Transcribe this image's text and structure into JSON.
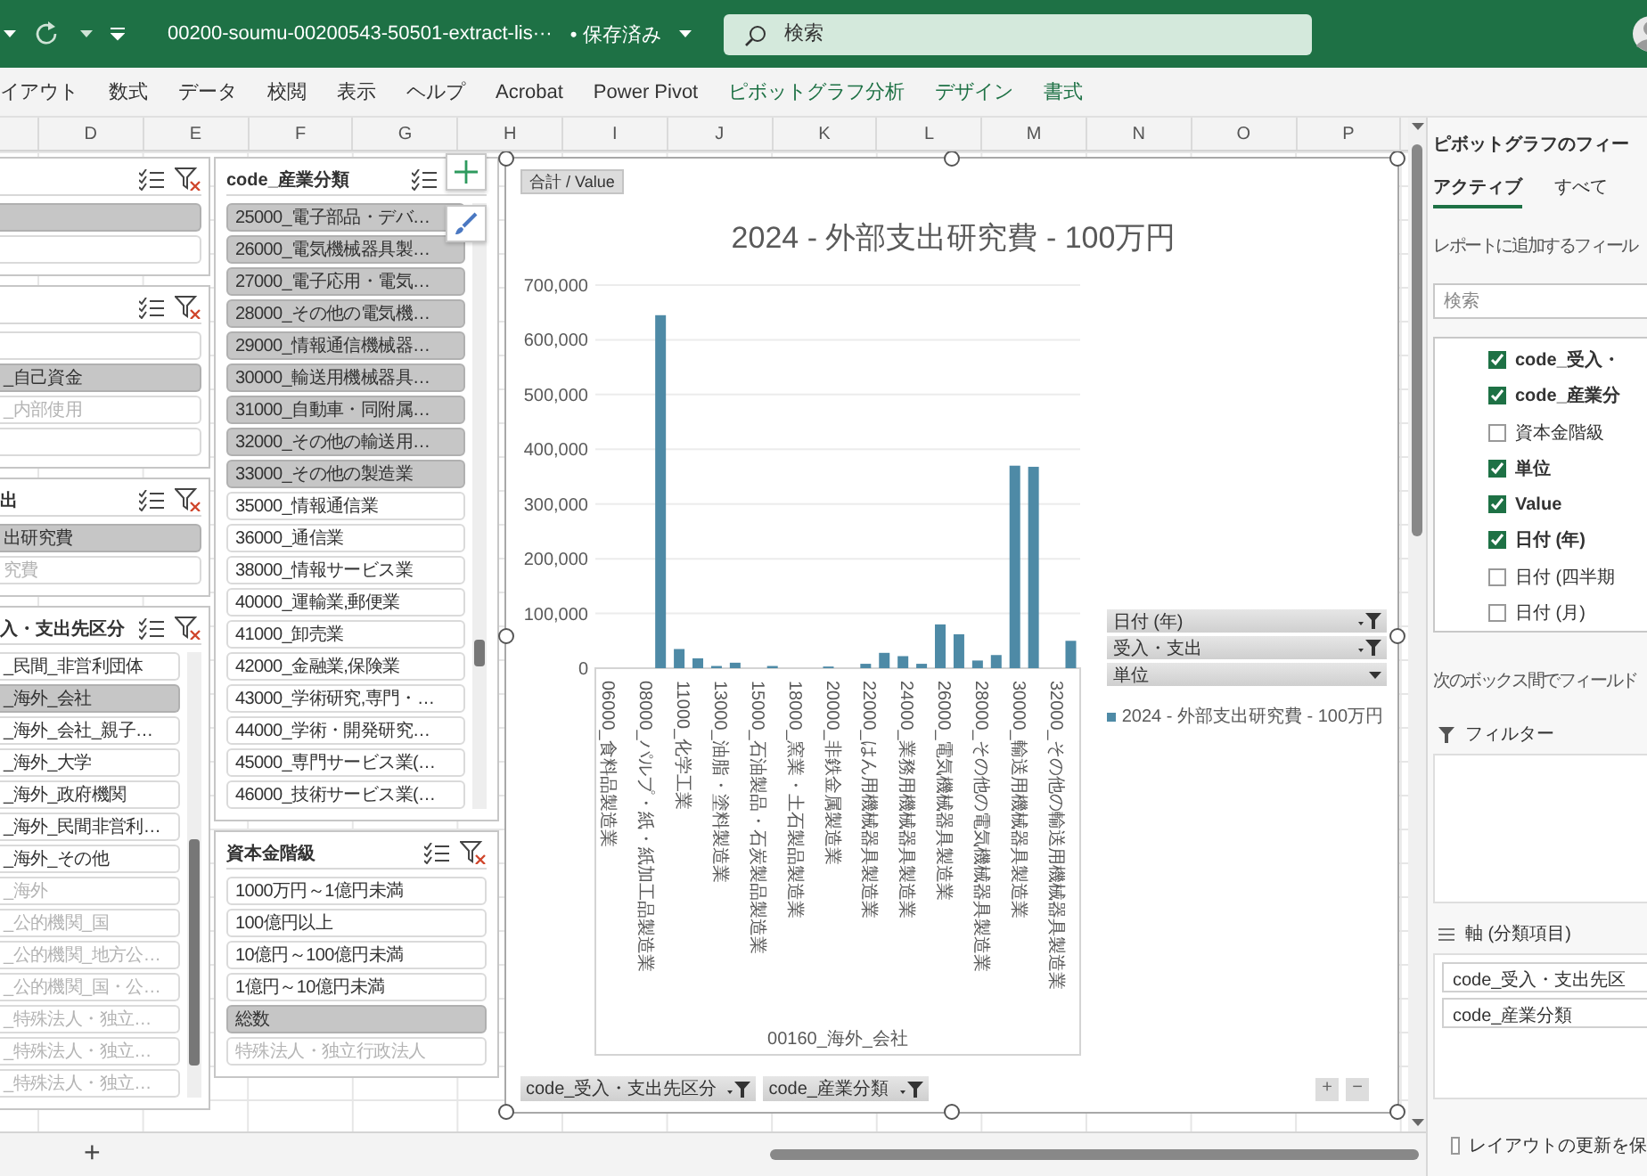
{
  "title_bar": {
    "file_name": "00200-soumu-00200543-50501-extract-lis···",
    "save_status": "• 保存済み",
    "search_placeholder": "検索"
  },
  "ribbon_tabs": [
    {
      "label": "イアウト",
      "contextual": false
    },
    {
      "label": "数式",
      "contextual": false
    },
    {
      "label": "データ",
      "contextual": false
    },
    {
      "label": "校閲",
      "contextual": false
    },
    {
      "label": "表示",
      "contextual": false
    },
    {
      "label": "ヘルプ",
      "contextual": false
    },
    {
      "label": "Acrobat",
      "contextual": false
    },
    {
      "label": "Power Pivot",
      "contextual": false
    },
    {
      "label": "ピボットグラフ分析",
      "contextual": true
    },
    {
      "label": "デザイン",
      "contextual": true
    },
    {
      "label": "書式",
      "contextual": true
    }
  ],
  "column_headers": [
    "D",
    "E",
    "F",
    "G",
    "H",
    "I",
    "J",
    "K",
    "L",
    "M",
    "N",
    "O",
    "P"
  ],
  "slicers_left": [
    {
      "items": [
        {
          "selected": true
        },
        {
          "selected": false
        }
      ]
    },
    {
      "items": [
        {
          "selected": false
        },
        {
          "label": "_自己資金",
          "selected": true,
          "has_data": true
        },
        {
          "label": "_内部使用",
          "selected": false,
          "has_data": false
        },
        {
          "selected": false
        }
      ]
    },
    {
      "title": "出",
      "items": [
        {
          "label": "出研究費",
          "selected": true,
          "has_data": true
        },
        {
          "label": "究費",
          "selected": false,
          "has_data": false
        }
      ]
    },
    {
      "title": "入・支出先区分",
      "items": [
        {
          "label": "_民間_非営利団体",
          "selected": false,
          "has_data": true
        },
        {
          "label": "_海外_会社",
          "selected": true,
          "has_data": true
        },
        {
          "label": "_海外_会社_親子…",
          "selected": false,
          "has_data": true
        },
        {
          "label": "_海外_大学",
          "selected": false,
          "has_data": true
        },
        {
          "label": "_海外_政府機関",
          "selected": false,
          "has_data": true
        },
        {
          "label": "_海外_民間非営利…",
          "selected": false,
          "has_data": true
        },
        {
          "label": "_海外_その他",
          "selected": false,
          "has_data": true
        },
        {
          "label": "_海外",
          "selected": false,
          "has_data": false
        },
        {
          "label": "_公的機関_国",
          "selected": false,
          "has_data": false
        },
        {
          "label": "_公的機関_地方公…",
          "selected": false,
          "has_data": false
        },
        {
          "label": "_公的機関_国・公…",
          "selected": false,
          "has_data": false
        },
        {
          "label": "_特殊法人・独立…",
          "selected": false,
          "has_data": false
        },
        {
          "label": "_特殊法人・独立…",
          "selected": false,
          "has_data": false
        },
        {
          "label": "_特殊法人・独立…",
          "selected": false,
          "has_data": false
        }
      ]
    }
  ],
  "slicers_middle": [
    {
      "title": "code_産業分類",
      "clear_filter_icon": false,
      "items": [
        {
          "label": "25000_電子部品・デバ…",
          "selected": true,
          "has_data": true
        },
        {
          "label": "26000_電気機械器具製…",
          "selected": true,
          "has_data": true
        },
        {
          "label": "27000_電子応用・電気…",
          "selected": true,
          "has_data": true
        },
        {
          "label": "28000_その他の電気機…",
          "selected": true,
          "has_data": true
        },
        {
          "label": "29000_情報通信機械器…",
          "selected": true,
          "has_data": true
        },
        {
          "label": "30000_輸送用機械器具…",
          "selected": true,
          "has_data": true
        },
        {
          "label": "31000_自動車・同附属…",
          "selected": true,
          "has_data": true
        },
        {
          "label": "32000_その他の輸送用…",
          "selected": true,
          "has_data": true
        },
        {
          "label": "33000_その他の製造業",
          "selected": true,
          "has_data": true
        },
        {
          "label": "35000_情報通信業",
          "selected": false,
          "has_data": true
        },
        {
          "label": "36000_通信業",
          "selected": false,
          "has_data": true
        },
        {
          "label": "38000_情報サービス業",
          "selected": false,
          "has_data": true
        },
        {
          "label": "40000_運輸業,郵便業",
          "selected": false,
          "has_data": true
        },
        {
          "label": "41000_卸売業",
          "selected": false,
          "has_data": true
        },
        {
          "label": "42000_金融業,保険業",
          "selected": false,
          "has_data": true
        },
        {
          "label": "43000_学術研究,専門・…",
          "selected": false,
          "has_data": true
        },
        {
          "label": "44000_学術・開発研究…",
          "selected": false,
          "has_data": true
        },
        {
          "label": "45000_専門サービス業(…",
          "selected": false,
          "has_data": true
        },
        {
          "label": "46000_技術サービス業(…",
          "selected": false,
          "has_data": true
        }
      ]
    },
    {
      "title": "資本金階級",
      "items": [
        {
          "label": "1000万円～1億円未満",
          "selected": false,
          "has_data": true
        },
        {
          "label": "100億円以上",
          "selected": false,
          "has_data": true
        },
        {
          "label": "10億円～100億円未満",
          "selected": false,
          "has_data": true
        },
        {
          "label": "1億円～10億円未満",
          "selected": false,
          "has_data": true
        },
        {
          "label": "総数",
          "selected": true,
          "has_data": true
        },
        {
          "label": "特殊法人・独立行政法人",
          "selected": false,
          "has_data": false
        }
      ]
    }
  ],
  "chart": {
    "value_button": "合計 / Value",
    "chart_data": {
      "type": "bar",
      "title": "2024 - 外部支出研究費 - 100万円",
      "xlabel": "00160_海外_会社",
      "categories": [
        "06000_食料品製造業",
        null,
        "08000_パルプ・紙・紙加工品製造業",
        null,
        "11000_化学工業",
        null,
        "13000_油脂・塗料製造業",
        null,
        "15000_石油製品・石炭製品製造業",
        null,
        "18000_窯業・土石製品製造業",
        null,
        "20000_非鉄金属製造業",
        null,
        "22000_はん用機械器具製造業",
        null,
        "24000_業務用機械器具製造業",
        null,
        "26000_電気機械器具製造業",
        null,
        "28000_その他の電気機械器具製造業",
        null,
        "30000_輸送用機械器具製造業",
        null,
        "32000_その他の輸送用機械器具製造業",
        null
      ],
      "series": [
        {
          "name": "2024 - 外部支出研究費 - 100万円",
          "color": "#4e8aa6",
          "values": [
            null,
            null,
            null,
            645000,
            35000,
            18000,
            4000,
            10000,
            null,
            4000,
            null,
            null,
            3000,
            null,
            8000,
            28000,
            22000,
            8000,
            80000,
            62000,
            14000,
            24000,
            370000,
            368000,
            null,
            50000
          ]
        }
      ],
      "ylim": [
        0,
        700000
      ],
      "grid": true,
      "yticks": [
        {
          "value": 0,
          "label": "0"
        },
        {
          "value": 100000,
          "label": "100,000"
        },
        {
          "value": 200000,
          "label": "200,000"
        },
        {
          "value": 300000,
          "label": "300,000"
        },
        {
          "value": 400000,
          "label": "400,000"
        },
        {
          "value": 500000,
          "label": "500,000"
        },
        {
          "value": 600000,
          "label": "600,000"
        },
        {
          "value": 700000,
          "label": "700,000"
        }
      ]
    },
    "legend_field_buttons": [
      {
        "label": "日付 (年)",
        "filtered": true
      },
      {
        "label": "受入・支出",
        "filtered": true
      },
      {
        "label": "単位",
        "filtered": false
      }
    ],
    "axis_field_buttons": [
      {
        "label": "code_受入・支出先区分",
        "filtered": true
      },
      {
        "label": "code_産業分類",
        "filtered": true
      }
    ],
    "zoom_buttons": [
      "+",
      "−"
    ]
  },
  "sheet_bar": {
    "add_label": "+"
  },
  "field_pane": {
    "title": "ピボットグラフのフィー",
    "tabs": [
      {
        "label": "アクティブ",
        "selected": true
      },
      {
        "label": "すべて",
        "selected": false
      }
    ],
    "instruction": "レポートに追加するフィール",
    "search_placeholder": "検索",
    "fields": [
      {
        "label": "code_受入・",
        "checked": true
      },
      {
        "label": "code_産業分",
        "checked": true
      },
      {
        "label": "資本金階級",
        "checked": false
      },
      {
        "label": "単位",
        "checked": true
      },
      {
        "label": "Value",
        "checked": true
      },
      {
        "label": "日付 (年)",
        "checked": true
      },
      {
        "label": "日付 (四半期",
        "checked": false
      },
      {
        "label": "日付 (月)",
        "checked": false
      }
    ],
    "drag_hint": "次のボックス間でフィールド",
    "areas": [
      {
        "kind": "filter",
        "label": "フィルター"
      },
      {
        "kind": "axis",
        "label": "軸 (分類項目)",
        "items": [
          "code_受入・支出先区",
          "code_産業分類"
        ]
      }
    ],
    "defer_update": {
      "label": "レイアウトの更新を保",
      "checked": false
    }
  }
}
